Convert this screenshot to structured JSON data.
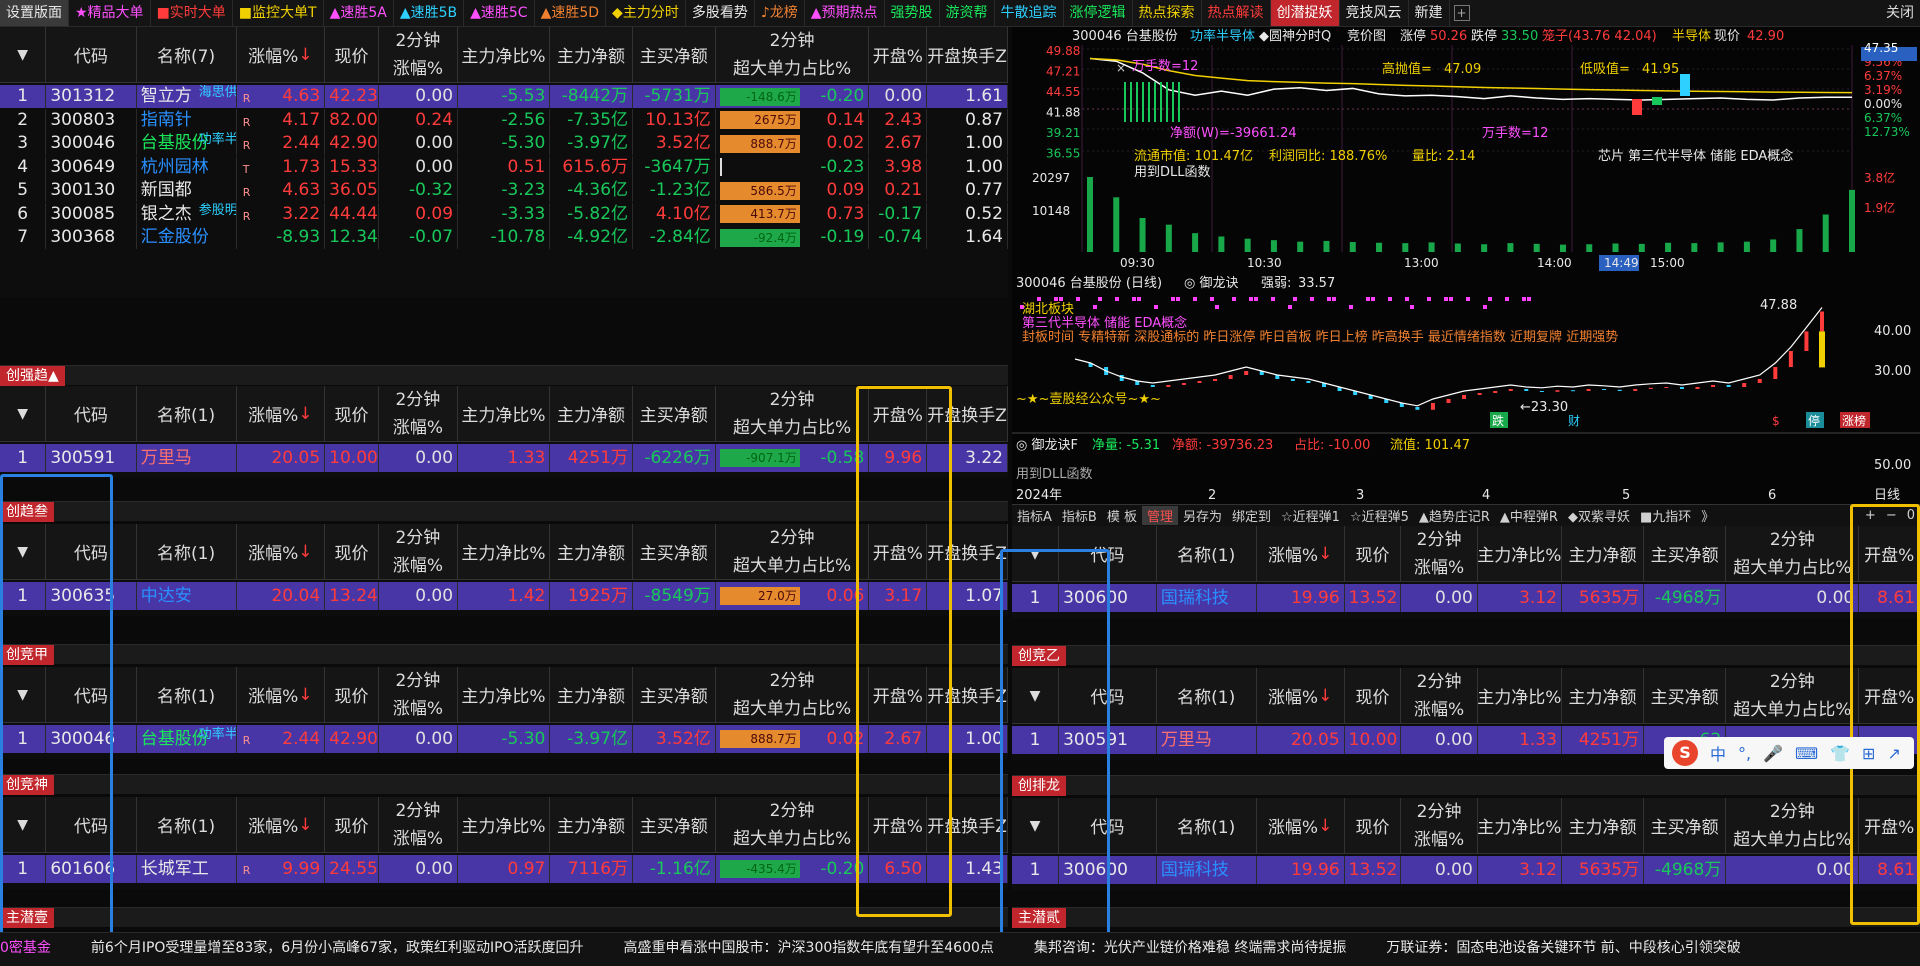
{
  "topbar": {
    "tabs": [
      "设置版面",
      "★精品大单",
      "■实时大单",
      "■监控大单T",
      "▲速胜5A",
      "▲速胜5B",
      "▲速胜5C",
      "▲速胜5D",
      "◆主力分时",
      "多股看势",
      "♪龙榜",
      "▲预期热点",
      "强势股",
      "游资帮",
      "牛散追踪",
      "涨停逻辑",
      "热点探索",
      "热点解读",
      "创潜捉妖",
      "竞技风云",
      "新建"
    ],
    "close": "关闭"
  },
  "colors": {
    "up": "#ff3b3b",
    "down": "#18c85a",
    "accent": "#c0262c",
    "selected": "#4936a6",
    "gold": "#f0c000",
    "blue": "#2a80e0"
  },
  "columns": {
    "no": "",
    "code": "代码",
    "chg": "涨幅%",
    "price": "现价",
    "two_top": "2分钟",
    "two_bot": "涨幅%",
    "net_ratio": "主力净比%",
    "net": "主力净额",
    "buy_net": "主买净额",
    "big_top": "2分钟",
    "big_bot": "超大单力占比%",
    "open": "开盘%",
    "turn": "开盘换手Z"
  },
  "main_table": {
    "name_col": "名称(7)",
    "rows": [
      {
        "no": "1",
        "code": "301312",
        "name": "智立方",
        "mark": "R",
        "chg": "4.63",
        "price": "42.23",
        "two": "0.00",
        "ratio": "-5.53",
        "net": "-8442万",
        "buy": "-5731万",
        "bar": "-148.6万",
        "big": "-0.20",
        "open": "0.00",
        "turn": "1.61",
        "note": "海思供应商"
      },
      {
        "no": "2",
        "code": "300803",
        "name": "指南针",
        "mark": "R",
        "chg": "4.17",
        "price": "82.00",
        "two": "0.24",
        "ratio": "-2.56",
        "net": "-7.35亿",
        "buy": "10.13亿",
        "bar": "2675万",
        "big": "0.14",
        "open": "2.43",
        "turn": "0.87",
        "note": ""
      },
      {
        "no": "3",
        "code": "300046",
        "name": "台基股份",
        "mark": "R",
        "chg": "2.44",
        "price": "42.90",
        "two": "0.00",
        "ratio": "-5.30",
        "net": "-3.97亿",
        "buy": "3.52亿",
        "bar": "888.7万",
        "big": "0.02",
        "open": "2.67",
        "turn": "1.00",
        "note": "功率半导体"
      },
      {
        "no": "4",
        "code": "300649",
        "name": "杭州园林",
        "mark": "T",
        "chg": "1.73",
        "price": "15.33",
        "two": "0.00",
        "ratio": "0.51",
        "net": "615.6万",
        "buy": "-3647万",
        "bar": "",
        "big": "-0.23",
        "open": "3.98",
        "turn": "1.00",
        "note": ""
      },
      {
        "no": "5",
        "code": "300130",
        "name": "新国都",
        "mark": "R",
        "chg": "4.63",
        "price": "36.05",
        "two": "-0.32",
        "ratio": "-3.23",
        "net": "-4.36亿",
        "buy": "-1.23亿",
        "bar": "586.5万",
        "big": "0.09",
        "open": "0.21",
        "turn": "0.77",
        "note": ""
      },
      {
        "no": "6",
        "code": "300085",
        "name": "银之杰",
        "mark": "R",
        "chg": "3.22",
        "price": "44.44",
        "two": "0.09",
        "ratio": "-3.33",
        "net": "-5.82亿",
        "buy": "4.10亿",
        "bar": "413.7万",
        "big": "0.73",
        "open": "-0.17",
        "turn": "0.52",
        "note": "参股明略科技"
      },
      {
        "no": "7",
        "code": "300368",
        "name": "汇金股份",
        "mark": "",
        "chg": "-8.93",
        "price": "12.34",
        "two": "-0.07",
        "ratio": "-10.78",
        "net": "-4.92亿",
        "buy": "-2.84亿",
        "bar": "-92.4万",
        "big": "-0.19",
        "open": "-0.74",
        "turn": "1.64",
        "note": ""
      }
    ]
  },
  "sections": [
    {
      "tag": "创强趋▲",
      "name_col": "名称(1)",
      "row": {
        "no": "1",
        "code": "300591",
        "name": "万里马",
        "mark": "",
        "chg": "20.05",
        "price": "10.00",
        "two": "0.00",
        "ratio": "1.33",
        "net": "4251万",
        "buy": "-6226万",
        "bar": "-907.1万",
        "big": "-0.58",
        "open": "9.96",
        "turn": "3.22",
        "note": ""
      }
    },
    {
      "tag": "创趋叁",
      "name_col": "名称(1)",
      "row": {
        "no": "1",
        "code": "300635",
        "name": "中达安",
        "mark": "",
        "chg": "20.04",
        "price": "13.24",
        "two": "0.00",
        "ratio": "1.42",
        "net": "1925万",
        "buy": "-8549万",
        "bar": "27.0万",
        "big": "0.06",
        "open": "3.17",
        "turn": "1.07",
        "note": ""
      }
    },
    {
      "tag": "创竞甲",
      "name_col": "名称(1)",
      "row": {
        "no": "1",
        "code": "300046",
        "name": "台基股份",
        "mark": "R",
        "chg": "2.44",
        "price": "42.90",
        "two": "0.00",
        "ratio": "-5.30",
        "net": "-3.97亿",
        "buy": "3.52亿",
        "bar": "888.7万",
        "big": "0.02",
        "open": "2.67",
        "turn": "1.00",
        "note": "功率半导体"
      }
    },
    {
      "tag": "创竞神",
      "name_col": "名称(1)",
      "row": {
        "no": "1",
        "code": "601606",
        "name": "长城军工",
        "mark": "R",
        "chg": "9.99",
        "price": "24.55",
        "two": "0.00",
        "ratio": "0.97",
        "net": "7116万",
        "buy": "-1.16亿",
        "bar": "-435.4万",
        "big": "-0.20",
        "open": "6.50",
        "turn": "1.43",
        "note": ""
      }
    }
  ],
  "end_tags": {
    "left": "主潜壹",
    "right": "主潜贰"
  },
  "right_sections": [
    {
      "tag": "",
      "name_col": "名称(1)",
      "row": {
        "no": "1",
        "code": "300600",
        "name": "国瑞科技",
        "chg": "19.96",
        "price": "13.52",
        "two": "0.00",
        "ratio": "3.12",
        "net": "5635万",
        "buy": "-4968万",
        "big": "0.00",
        "open": "8.61"
      }
    },
    {
      "tag": "创竞乙",
      "name_col": "名称(1)",
      "row": {
        "no": "1",
        "code": "300591",
        "name": "万里马",
        "chg": "20.05",
        "price": "10.00",
        "two": "0.00",
        "ratio": "1.33",
        "net": "4251万",
        "buy": "-62",
        "big": "",
        "open": ""
      }
    },
    {
      "tag": "创排龙",
      "name_col": "名称(1)",
      "row": {
        "no": "1",
        "code": "300600",
        "name": "国瑞科技",
        "chg": "19.96",
        "price": "13.52",
        "two": "0.00",
        "ratio": "3.12",
        "net": "5635万",
        "buy": "-4968万",
        "big": "0.00",
        "open": "8.61"
      }
    }
  ],
  "intraday": {
    "header": "300046 台基股份",
    "concept": "功率半导体",
    "indicator": "◆圆神分时Q",
    "bid": "竞价图",
    "zt_label": "涨停",
    "zt": "50.26",
    "dt_label": "跌停",
    "dt": "33.50",
    "chip": "笼子(43.76 42.04)",
    "sector": "半导体",
    "price_label": "现价",
    "price": "42.90",
    "y_left": [
      "49.88",
      "47.21",
      "44.55",
      "41.88",
      "39.21",
      "36.55"
    ],
    "y_right": [
      "47.35",
      "9.56%",
      "6.37%",
      "3.19%",
      "0.00%",
      "6.37%",
      "12.73%"
    ],
    "vol_left": [
      "20297",
      "10148"
    ],
    "vol_right": [
      "3.8亿",
      "1.9亿"
    ],
    "times": [
      "09:30",
      "10:30",
      "13:00",
      "14:00",
      "14:49",
      "15:00"
    ],
    "hi_label": "高抛值=",
    "hi": "47.09",
    "lo_label": "低吸值=",
    "lo": "41.95",
    "hands_top": "万手数=12",
    "hands_bot": "万手数=12",
    "jin_e": "净额(W)=-39661.24",
    "float_cap": "流通市值: 101.47亿",
    "profit": "利润同比: 188.76%",
    "vol_ratio": "量比: 2.14",
    "tags": "芯片 第三代半导体 储能 EDA概念",
    "dll": "用到DLL函数",
    "x": "×",
    "chart_data": {
      "type": "line",
      "price_range": [
        35.0,
        50.0
      ],
      "series": [
        {
          "values": [
            48.6,
            48.2,
            46.5,
            44.0,
            43.2,
            43.8,
            43.2,
            44.1,
            44.3,
            43.9,
            44.2,
            43.4,
            43.1,
            43.2,
            43.0,
            42.7,
            43.1,
            42.8,
            42.6,
            42.7,
            42.6,
            42.5,
            42.6,
            42.7,
            42.8,
            42.6,
            42.5,
            42.8,
            42.9,
            42.9
          ]
        }
      ],
      "volume": [
        20297,
        14800,
        9200,
        7400,
        5100,
        4200,
        3600,
        3200,
        2800,
        3000,
        2700,
        2500,
        2400,
        2600,
        2300,
        2100,
        2400,
        2200,
        2000,
        2100,
        2300,
        2200,
        2500,
        2400,
        2600,
        2800,
        3400,
        6200,
        10148,
        16800
      ]
    }
  },
  "daily": {
    "header": "300046 台基股份 (日线)",
    "indicator": "◎ 御龙诀",
    "strength_label": "强弱:",
    "strength": "33.57",
    "peak": "47.88",
    "low_mark": "←23.30",
    "tags_row1": "湖北板块",
    "tags_row2": "第三代半导体 储能 EDA概念",
    "tags_row3": "封板时间 专精特新 深股通标的 昨日涨停 昨日首板 昨日上榜 昨高换手 最近情绪指数 近期复牌 近期强势",
    "y": [
      "40.00",
      "30.00"
    ],
    "sig": "~★~壹股经公众号~★~",
    "marks": [
      "跌",
      "财",
      "$",
      "停",
      "涨榜"
    ],
    "sub_label": "◎ 御龙诀F",
    "sub_jing": "净量: -5.31",
    "sub_jine": "净额: -39736.23",
    "sub_zb": "占比: -10.00",
    "sub_lt": "流值: 101.47",
    "sub_dll": "用到DLL函数",
    "sub_y": "50.00",
    "year": "2024年",
    "months": [
      "2",
      "3",
      "4",
      "5",
      "6"
    ],
    "period": "日线",
    "chart_data": {
      "type": "line",
      "price_range": [
        20,
        50
      ],
      "series": [
        {
          "name": "close",
          "values": [
            35,
            34,
            32,
            30.5,
            29.5,
            29,
            29.5,
            30,
            30.5,
            31,
            32,
            33,
            32,
            31,
            30.5,
            30,
            29,
            28,
            27,
            26,
            25,
            24,
            23.3,
            25,
            26,
            27,
            27.5,
            28,
            28.5,
            28,
            27.8,
            28.2,
            28,
            28.5,
            28.3,
            28,
            28.5,
            28.8,
            29,
            28.5,
            29,
            29.5,
            29,
            30,
            31,
            34,
            38,
            42.9,
            47.88
          ]
        }
      ]
    }
  },
  "ind_tabs": [
    "指标A",
    "指标B",
    "模 板",
    "管理",
    "另存为",
    "绑定到",
    "☆近程弹1",
    "☆近程弹5",
    "▲趋势庄记R",
    "▲中程弹R",
    "◆双紫寻妖",
    "■九指环",
    "》"
  ],
  "ind_controls": [
    "+",
    "−",
    "0"
  ],
  "ime": {
    "s": "S",
    "items": [
      "中",
      "°,",
      "🎤",
      "⌨",
      "👕",
      "⊞",
      "↗"
    ]
  },
  "ticker": [
    "0密基金",
    "前6个月IPO受理量增至83家，6月份小高峰67家，政策红利驱动IPO活跃度回升",
    "高盛重申看涨中国股市：沪深300指数年底有望升至4600点",
    "集邦咨询：光伏产业链价格难稳 终端需求尚待提振",
    "万联证券：固态电池设备关键环节 前、中段核心引领突破"
  ]
}
